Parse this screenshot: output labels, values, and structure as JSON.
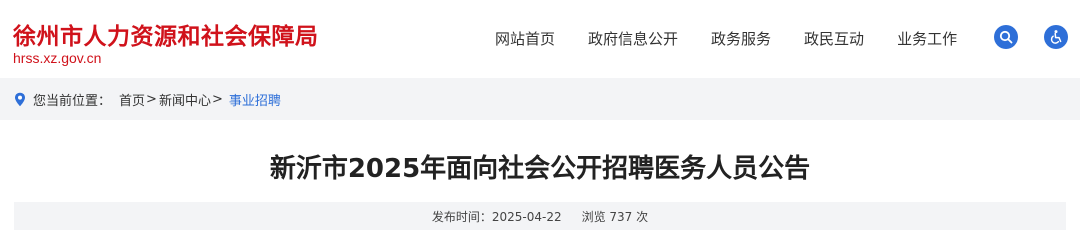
{
  "site": {
    "title": "徐州市人力资源和社会保障局",
    "domain": "hrss.xz.gov.cn"
  },
  "nav": {
    "items": [
      {
        "label": "网站首页"
      },
      {
        "label": "政府信息公开"
      },
      {
        "label": "政务服务"
      },
      {
        "label": "政民互动"
      },
      {
        "label": "业务工作"
      }
    ]
  },
  "icons": {
    "search": "search-icon",
    "accessibility": "accessibility-icon",
    "location": "location-pin-icon"
  },
  "breadcrumb": {
    "prefix": "您当前位置：",
    "items": [
      "首页",
      "新闻中心",
      "事业招聘"
    ],
    "separator": ">"
  },
  "article": {
    "title": "新沂市2025年面向社会公开招聘医务人员公告",
    "publish_label": "发布时间：2025-04-22",
    "views_label": "浏览 737 次"
  },
  "colors": {
    "brand": "#d0121b",
    "accent": "#2e6fd8",
    "bar_bg": "#f3f4f6"
  }
}
